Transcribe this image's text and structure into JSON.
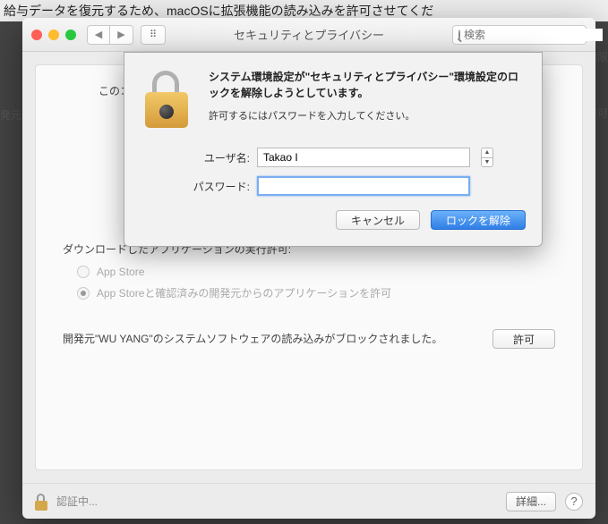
{
  "bg_text": "給与データを復元するため、macOSに拡張機能の読み込みを許可させてくだ",
  "side_left": "発元",
  "side_right": "許可",
  "side_right2": "権限",
  "window": {
    "title": "セキュリティとプライバシー",
    "search_placeholder": "検索"
  },
  "panel": {
    "top_text": "このコ",
    "downloads_label": "ダウンロードしたアプリケーションの実行許可:",
    "radio1": "App Store",
    "radio2": "App Storeと確認済みの開発元からのアプリケーションを許可",
    "block_text": "開発元\"WU YANG\"のシステムソフトウェアの読み込みがブロックされました。",
    "allow": "許可"
  },
  "footer": {
    "text": "認証中...",
    "details": "詳細...",
    "help": "?"
  },
  "dialog": {
    "bold": "システム環境設定が\"セキュリティとプライバシー\"環境設定のロックを解除しようとしています。",
    "sub": "許可するにはパスワードを入力してください。",
    "user_label": "ユーザ名:",
    "user_value": "Takao I",
    "pass_label": "パスワード:",
    "cancel": "キャンセル",
    "unlock": "ロックを解除"
  }
}
